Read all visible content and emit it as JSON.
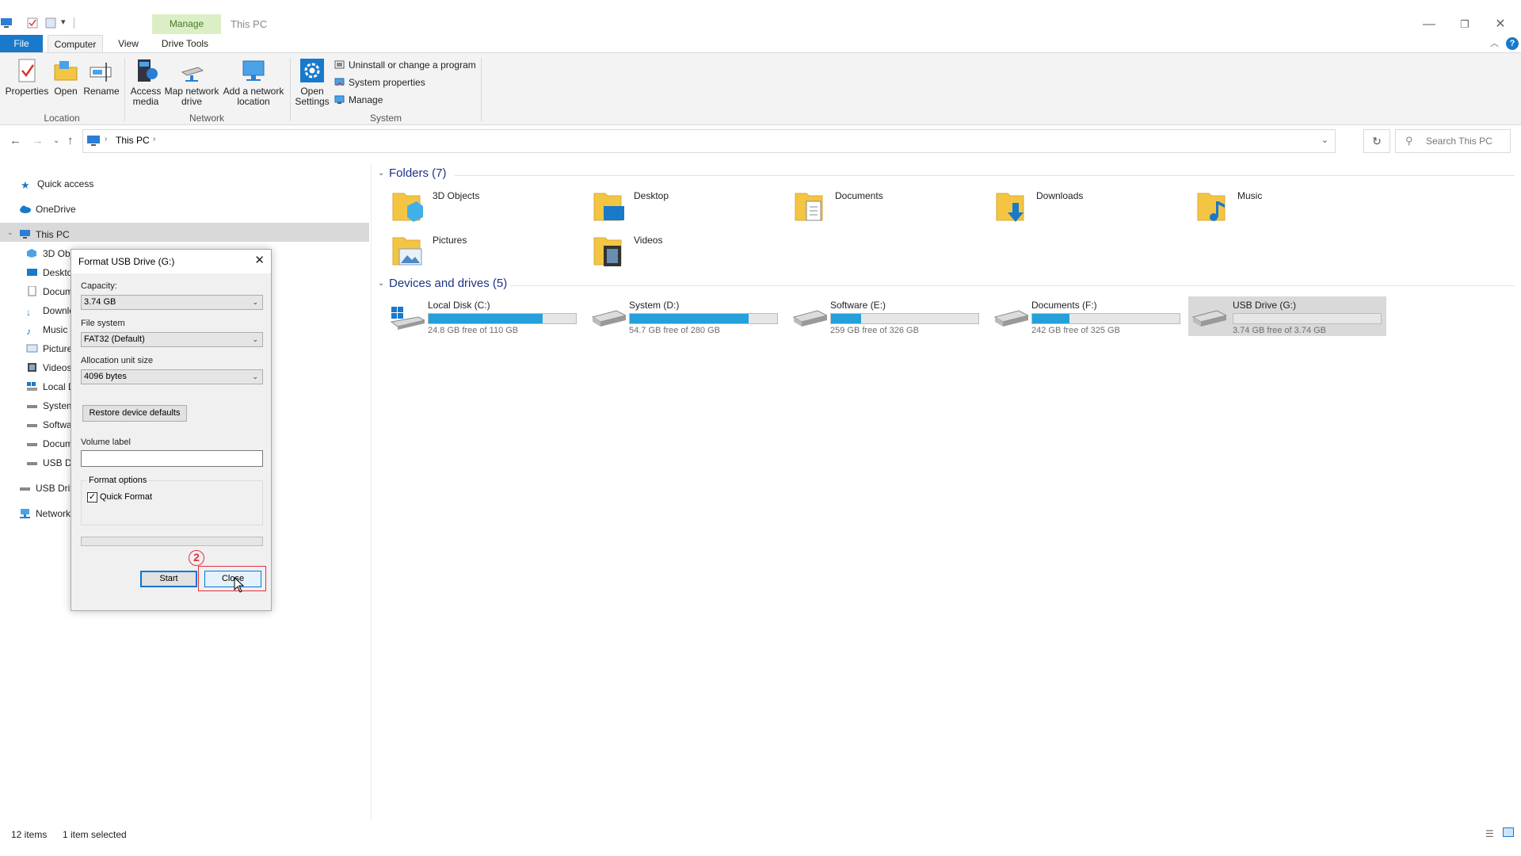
{
  "window": {
    "title": "This PC",
    "contextual_tab": "Manage"
  },
  "ribbon_tabs": {
    "file": "File",
    "computer": "Computer",
    "view": "View",
    "drive_tools": "Drive Tools"
  },
  "ribbon": {
    "properties": "Properties",
    "open": "Open",
    "rename": "Rename",
    "access_media": "Access media",
    "map_network_drive": "Map network drive",
    "add_network_location": "Add a network location",
    "open_settings": "Open Settings",
    "uninstall": "Uninstall or change a program",
    "system_properties": "System properties",
    "manage": "Manage",
    "group_location": "Location",
    "group_network": "Network",
    "group_system": "System"
  },
  "address": {
    "path": "This PC",
    "search_placeholder": "Search This PC"
  },
  "nav": {
    "quick_access": "Quick access",
    "onedrive": "OneDrive",
    "this_pc": "This PC",
    "objects3d": "3D Obj",
    "desktop": "Deskto",
    "documents": "Docum",
    "downloads": "Downlo",
    "music": "Music",
    "pictures": "Picture",
    "videos": "Videos",
    "local_disk": "Local D",
    "system": "System",
    "software": "Softwa",
    "documents_drive": "Docum",
    "usb_drive": "USB Dri",
    "usb_drive_root": "USB Driv",
    "network": "Network"
  },
  "folders": {
    "heading": "Folders (7)",
    "items": [
      {
        "name": "3D Objects"
      },
      {
        "name": "Desktop"
      },
      {
        "name": "Documents"
      },
      {
        "name": "Downloads"
      },
      {
        "name": "Music"
      },
      {
        "name": "Pictures"
      },
      {
        "name": "Videos"
      }
    ]
  },
  "drives": {
    "heading": "Devices and drives (5)",
    "items": [
      {
        "name": "Local Disk (C:)",
        "free": "24.8 GB free of 110 GB",
        "used_fraction": 0.775
      },
      {
        "name": "System (D:)",
        "free": "54.7 GB free of 280 GB",
        "used_fraction": 0.805
      },
      {
        "name": "Software (E:)",
        "free": "259 GB free of 326 GB",
        "used_fraction": 0.205
      },
      {
        "name": "Documents (F:)",
        "free": "242 GB free of 325 GB",
        "used_fraction": 0.255
      },
      {
        "name": "USB Drive (G:)",
        "free": "3.74 GB free of 3.74 GB",
        "used_fraction": 0.0
      }
    ]
  },
  "status": {
    "items": "12 items",
    "selected": "1 item selected"
  },
  "dialog": {
    "title": "Format USB Drive (G:)",
    "capacity_label": "Capacity:",
    "capacity_value": "3.74 GB",
    "fs_label": "File system",
    "fs_value": "FAT32 (Default)",
    "alloc_label": "Allocation unit size",
    "alloc_value": "4096 bytes",
    "restore_button": "Restore device defaults",
    "volume_label": "Volume label",
    "volume_value": "",
    "format_options": "Format options",
    "quick_format": "Quick Format",
    "quick_format_checked": true,
    "start_button": "Start",
    "close_button": "Close",
    "step_number": "2"
  },
  "colors": {
    "accent": "#1979ca",
    "drive_bar": "#26a0da",
    "annotation": "#e03040",
    "section_heading": "#1e3287"
  }
}
